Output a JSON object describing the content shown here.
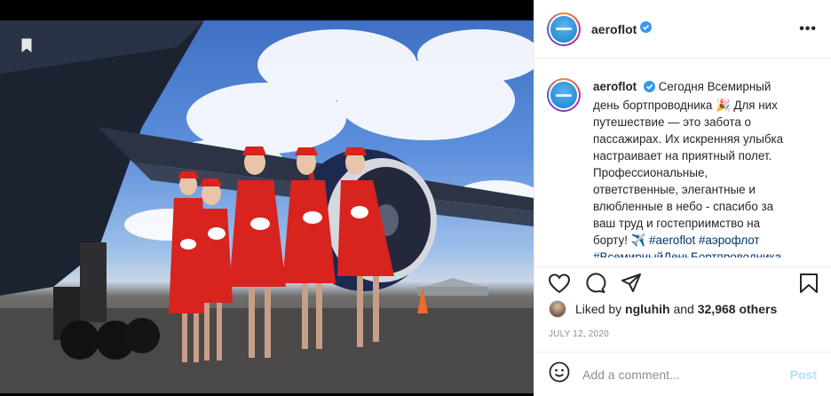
{
  "post": {
    "account": "aeroflot",
    "verified": true,
    "more_label": "•••",
    "caption": {
      "text": "Сегодня Всемирный день бортпроводника 🎉 Для них путешествие — это забота о пассажирах. Их искренняя улыбка настраивает на приятный полет. Профессиональные, ответственные, элегантные и влюбленные в небо - спасибо за ваш труд и гостеприимство на борту! ✈️",
      "hashtags": [
        "#aeroflot",
        "#аэрофлот",
        "#ВсемирныйДеньБортпроводника"
      ]
    },
    "likes": {
      "prefix": "Liked by",
      "user": "ngluhih",
      "and": "and",
      "count": "32,968 others"
    },
    "date": "JULY 12, 2020",
    "comment": {
      "placeholder": "Add a comment...",
      "post_label": "Post"
    }
  },
  "icons": {
    "photo_overlay": "bookmark-icon",
    "like": "heart-icon",
    "comment": "comment-bubble-icon",
    "share": "paper-plane-icon",
    "save": "bookmark-icon",
    "emoji": "smiley-icon",
    "badge": "verified-badge-icon"
  },
  "colors": {
    "verified": "#3897f0",
    "link": "#00376b",
    "post_disabled": "#b2dffc",
    "uniform": "#d8231e"
  }
}
